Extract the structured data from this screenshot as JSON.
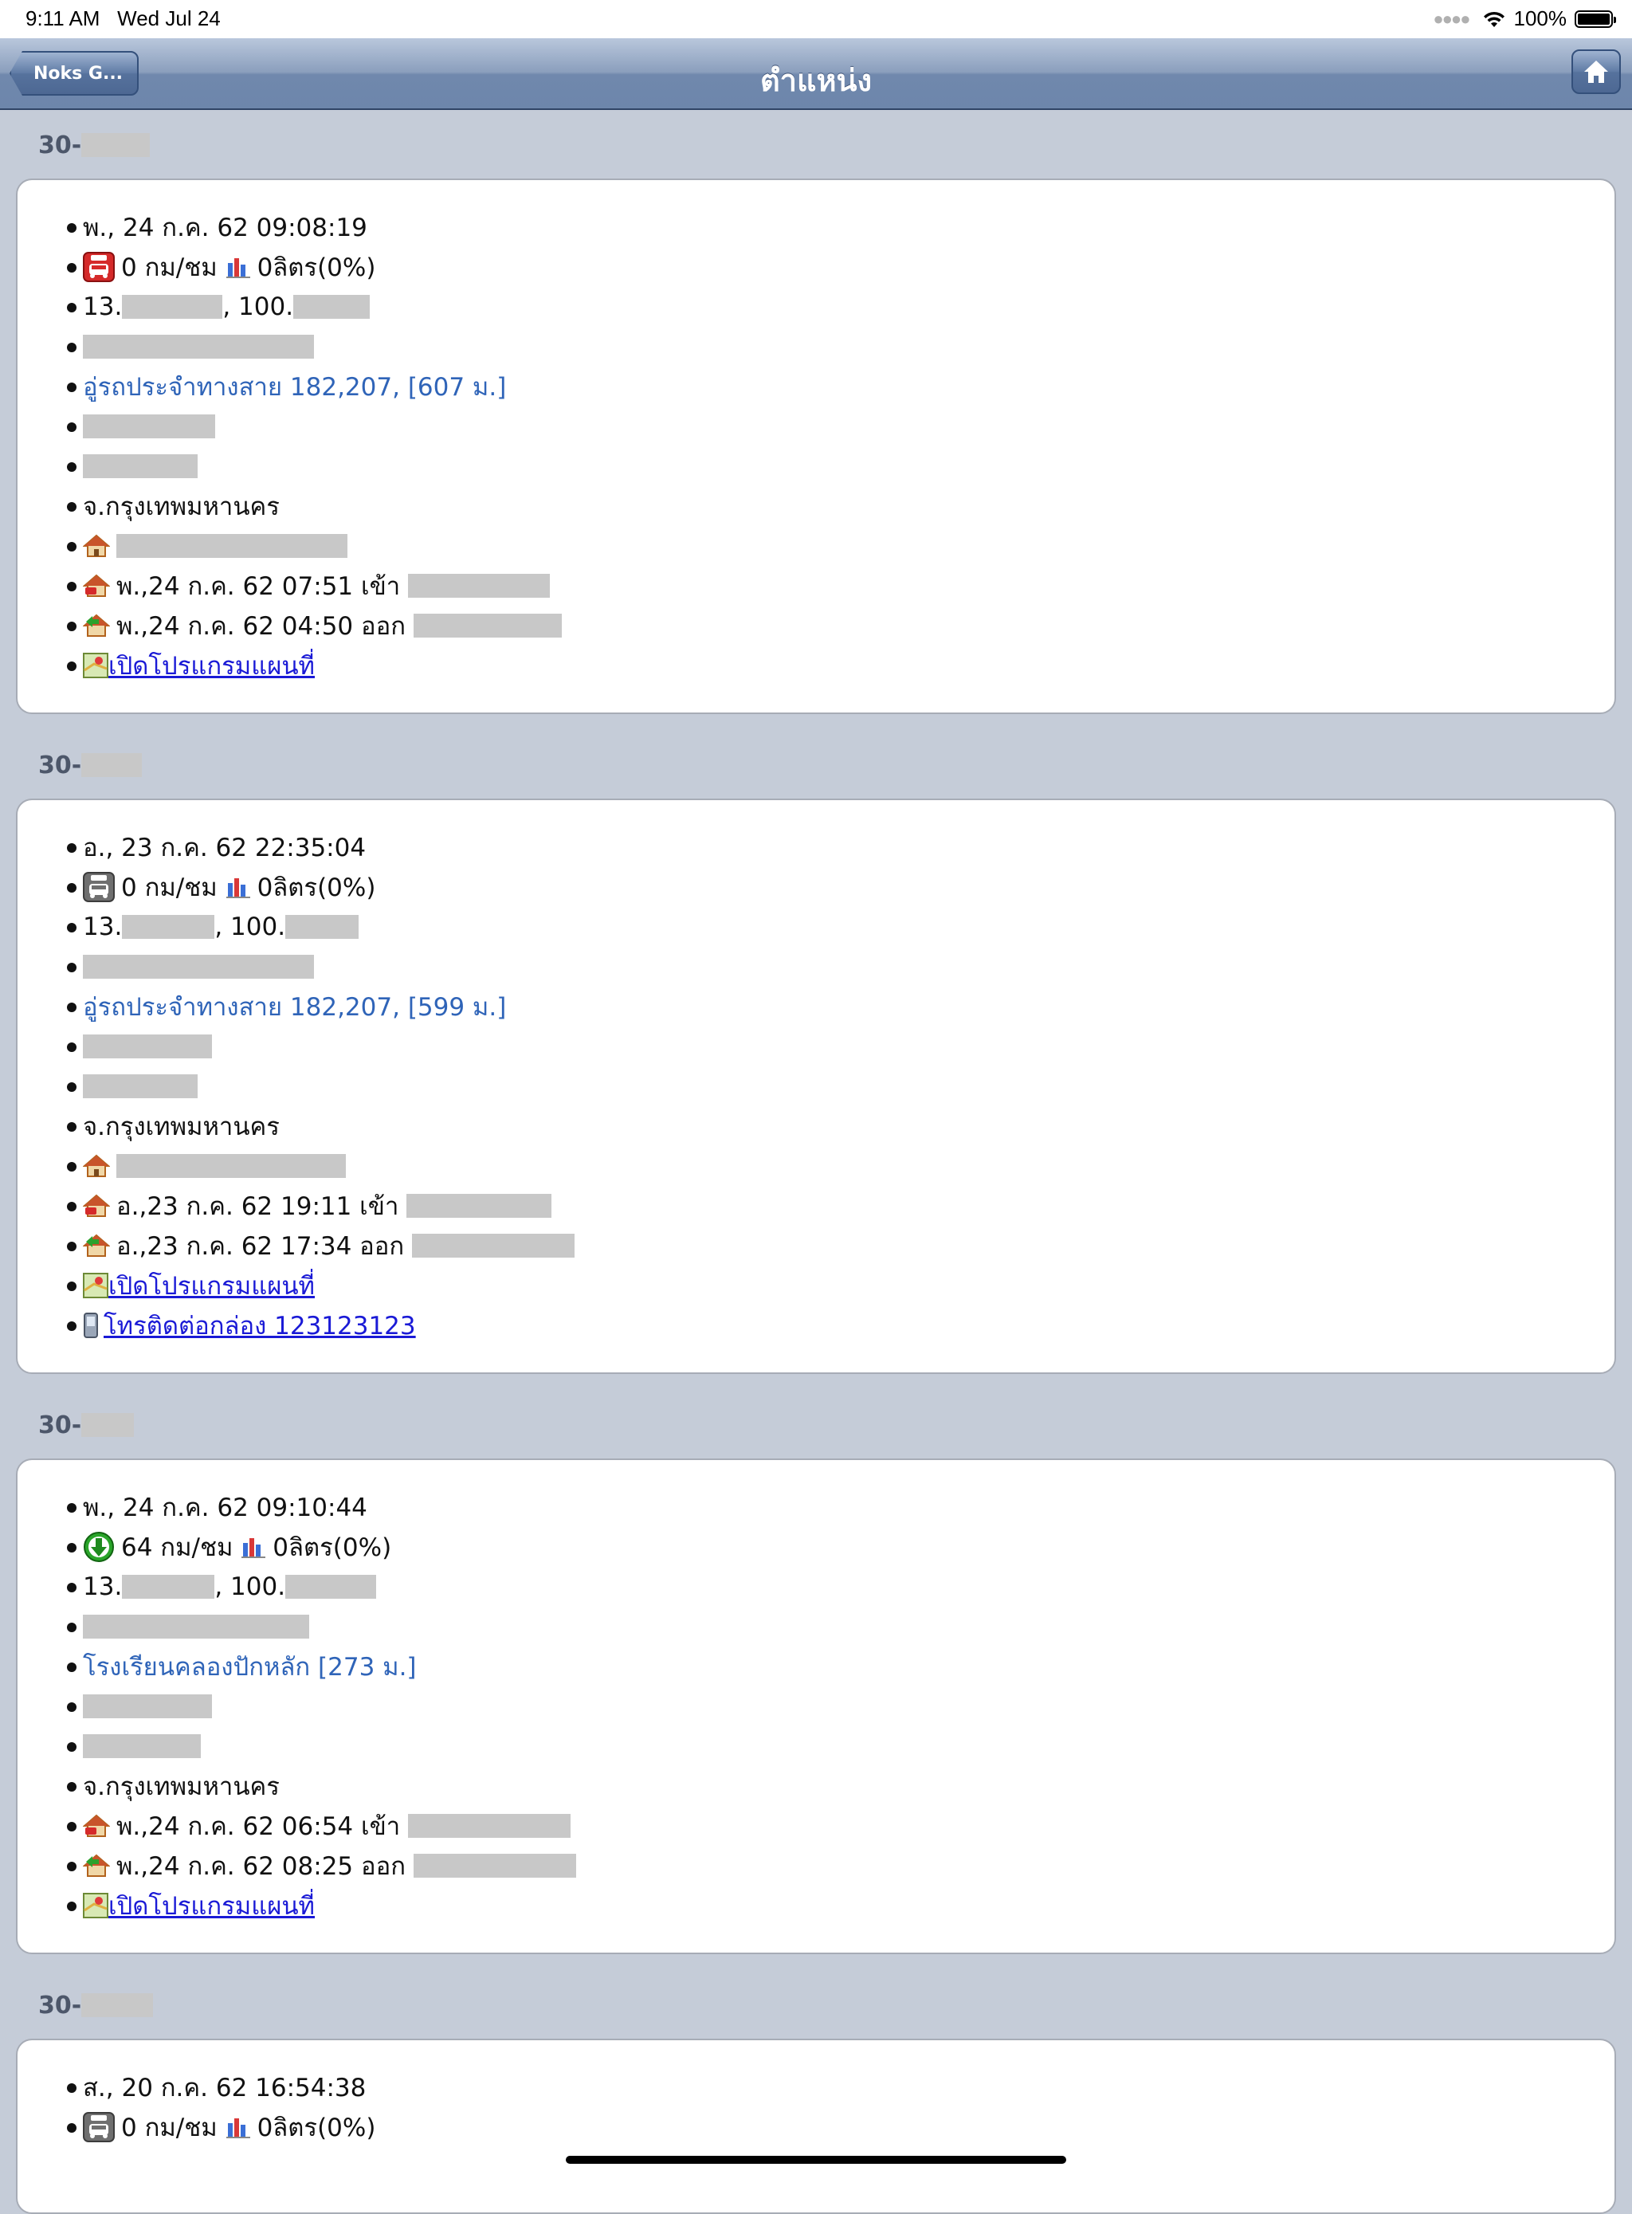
{
  "status_bar": {
    "time": "9:11 AM",
    "date": "Wed Jul 24",
    "battery": "100%",
    "battery_level": 1.0
  },
  "nav": {
    "back_label": "Noks G...",
    "title": "ตำแหน่ง",
    "home_icon": "home-icon"
  },
  "colors": {
    "nav_gradient_top": "#b9c7dc",
    "nav_gradient_bottom": "#6d86ab",
    "link": "#1a1ad6",
    "place": "#2f64b8",
    "page_bg": "#c5ccd8"
  },
  "cards": [
    {
      "plate": "30-",
      "datetime": "พ., 24 ก.ค. 62 09:08:19",
      "status_icon": "parked-red-icon",
      "speed": "0 กม/ชม",
      "fuel": "0ลิตร(0%)",
      "lat_prefix": "13.",
      "lon_prefix": ", 100.",
      "place": "อู่รถประจำทางสาย 182,207, [607 ม.]",
      "province": "จ.กรุงเทพมหานคร",
      "enter": "พ.,24 ก.ค. 62 07:51 เข้า",
      "exit": "พ.,24 ก.ค. 62 04:50 ออก",
      "map_link": "เปิดโปรแกรมแผนที่"
    },
    {
      "plate": "30-",
      "datetime": "อ., 23 ก.ค. 62 22:35:04",
      "status_icon": "parked-gray-icon",
      "speed": "0 กม/ชม",
      "fuel": "0ลิตร(0%)",
      "lat_prefix": "13.",
      "lon_prefix": ", 100.",
      "place": "อู่รถประจำทางสาย 182,207, [599 ม.]",
      "province": "จ.กรุงเทพมหานคร",
      "enter": "อ.,23 ก.ค. 62 19:11 เข้า",
      "exit": "อ.,23 ก.ค. 62 17:34 ออก",
      "map_link": "เปิดโปรแกรมแผนที่",
      "call_link": "โทรติดต่อกล่อง 123123123"
    },
    {
      "plate": "30-",
      "datetime": "พ., 24 ก.ค. 62 09:10:44",
      "status_icon": "moving-green-arrow-icon",
      "speed": "64 กม/ชม",
      "fuel": "0ลิตร(0%)",
      "lat_prefix": "13.",
      "lon_prefix": ", 100.",
      "place": "โรงเรียนคลองปักหลัก [273 ม.]",
      "province": "จ.กรุงเทพมหานคร",
      "enter": "พ.,24 ก.ค. 62 06:54 เข้า",
      "exit": "พ.,24 ก.ค. 62 08:25 ออก",
      "map_link": "เปิดโปรแกรมแผนที่"
    },
    {
      "plate": "30-",
      "datetime": "ส., 20 ก.ค. 62 16:54:38",
      "status_icon": "parked-gray-icon",
      "speed": "0 กม/ชม",
      "fuel": "0ลิตร(0%)"
    }
  ]
}
